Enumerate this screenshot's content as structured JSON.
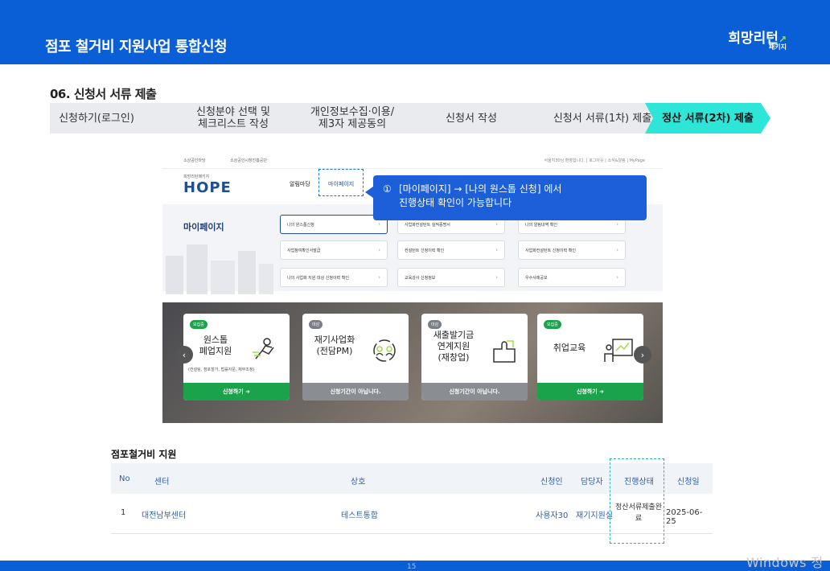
{
  "header": {
    "title": "점포 철거비 지원사업 통합신청",
    "logo_main": "희망리턴",
    "logo_sub": "패키지"
  },
  "section": {
    "title": "06. 신청서 서류 제출"
  },
  "steps": [
    {
      "label": "신청하기(로그인)"
    },
    {
      "label": "신청분야 선택 및\n체크리스트 작성"
    },
    {
      "label": "개인정보수집·이용/\n제3자 제공동의"
    },
    {
      "label": "신청서 작성"
    },
    {
      "label": "신청서 서류(1차) 제출"
    },
    {
      "label": "정산 서류(2차) 제출"
    }
  ],
  "colors": {
    "brand": "#0a5fd7",
    "step_active": "#2ee6d8",
    "step": "#e9ebef",
    "callout": "#1c5fd8",
    "green": "#1aa34a",
    "grey_btn": "#8a8d92",
    "highlight": "#2fb8a8"
  },
  "screenshot": {
    "util_org1": "소상공인마당",
    "util_org2": "소상공인시장진흥공단",
    "util_right": "서울지30님 환영합니다.  |  로그아웃  |  소식&알림  |  MyPage",
    "hope_small": "희망리턴패키지",
    "hope": "HOPE",
    "menu1": "알림마당",
    "menu2": "마이페이지",
    "mypage_label": "마이페이지",
    "pills": [
      "나의 원스톱신청",
      "사업화컨설턴트 실적증명서",
      "나의 알림내역 확인",
      "사업참여확인서발급",
      "컨설턴트 신청이력 확인",
      "사업화컨설턴트 신청이력 확인",
      "나의 사업화 지원 대상 신청이력 확인",
      "교육강사 신청정보",
      "우수사례공모"
    ],
    "callout_num": "①",
    "callout_line1": "[마이페이지] → [나의 원스톱 신청] 에서",
    "callout_line2": "진행상태 확인이 가능합니다",
    "cards": [
      {
        "tag": "모집중",
        "name": "원스톱\n폐업지원",
        "note": "(컨설팅, 점포철거, 법률자문, 채무조정)",
        "button": "신청하기 ➜",
        "open": true
      },
      {
        "tag": "마감",
        "name": "재기사업화\n(전담PM)",
        "note": "",
        "button": "신청기간이 아닙니다.",
        "open": false
      },
      {
        "tag": "마감",
        "name": "새출발기금\n연계지원\n(재창업)",
        "note": "",
        "button": "신청기간이 아닙니다.",
        "open": false
      },
      {
        "tag": "모집중",
        "name": "취업교육",
        "note": "",
        "button": "신청하기 ➜",
        "open": true
      }
    ],
    "prev": "‹",
    "next": "›"
  },
  "table": {
    "title": "점포철거비 지원",
    "headers": [
      "No",
      "센터",
      "상호",
      "신청인",
      "담당자",
      "진행상태",
      "신청일"
    ],
    "rows": [
      [
        "1",
        "대전남부센터",
        "테스트통합",
        "사용자30",
        "재기지원실",
        "정산서류제출완료",
        "2025-06-25"
      ]
    ]
  },
  "footer": {
    "page": "15",
    "watermark": "Windows 정"
  }
}
